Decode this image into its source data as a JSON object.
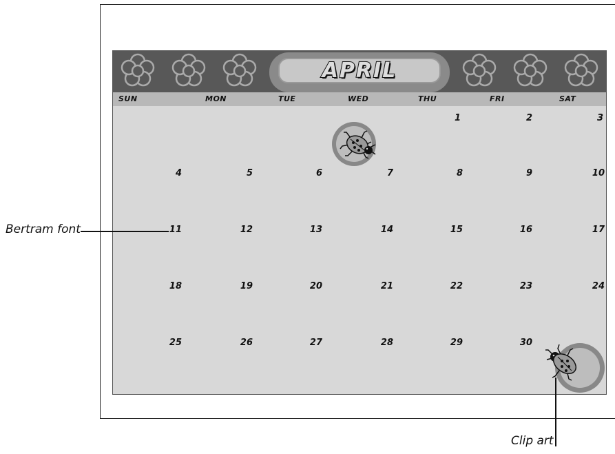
{
  "calendar": {
    "month": "APRIL",
    "day_names": [
      "SUN",
      "MON",
      "TUE",
      "WED",
      "THU",
      "FRI",
      "SAT"
    ],
    "weeks": [
      [
        "",
        "",
        "",
        "",
        "1",
        "2",
        "3"
      ],
      [
        "4",
        "5",
        "6",
        "7",
        "8",
        "9",
        "10"
      ],
      [
        "11",
        "12",
        "13",
        "14",
        "15",
        "16",
        "17"
      ],
      [
        "18",
        "19",
        "20",
        "21",
        "22",
        "23",
        "24"
      ],
      [
        "25",
        "26",
        "27",
        "28",
        "29",
        "30",
        ""
      ]
    ],
    "icons": [
      "flower-icon",
      "ladybug-icon"
    ]
  },
  "callouts": {
    "font_label": "Bertram font",
    "clipart_label": "Clip art"
  },
  "colors": {
    "banner": "#585858",
    "grid": "#d8d8d8",
    "dayrow": "#b8b8b8",
    "badge": "#8a8a8a"
  }
}
